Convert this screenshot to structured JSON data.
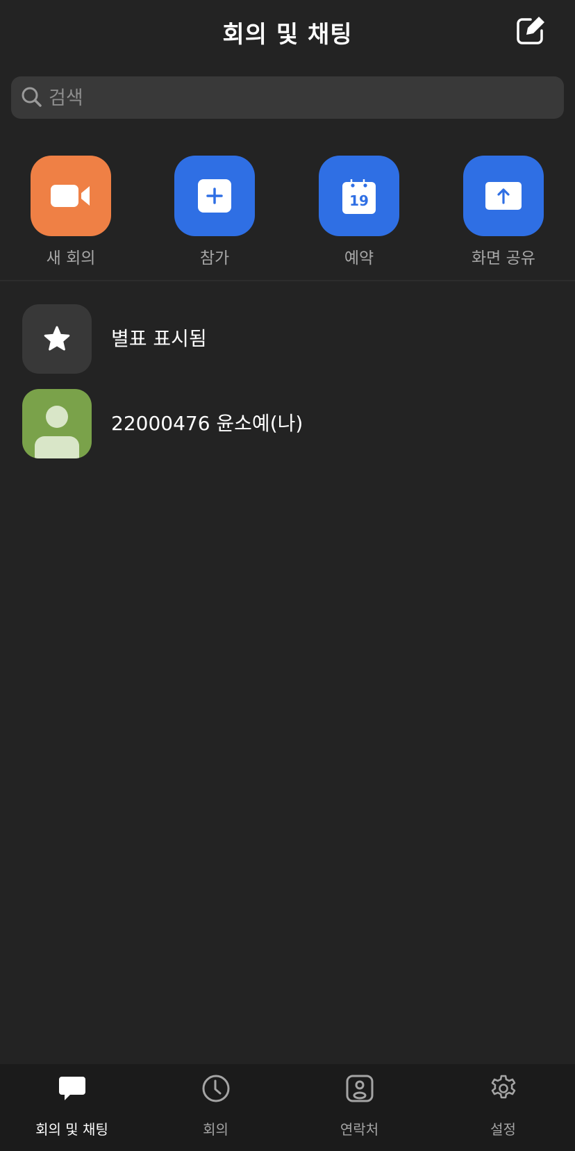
{
  "header": {
    "title": "회의 및 채팅",
    "compose_icon": "compose-icon"
  },
  "search": {
    "placeholder": "검색",
    "icon": "search-icon"
  },
  "quick_actions": [
    {
      "label": "새 회의",
      "icon": "video-camera-icon",
      "color": "#ef8045"
    },
    {
      "label": "참가",
      "icon": "plus-icon",
      "color": "#2f6fe4"
    },
    {
      "label": "예약",
      "icon": "calendar-icon",
      "calendar_day": "19",
      "color": "#2f6fe4"
    },
    {
      "label": "화면 공유",
      "icon": "upload-screen-icon",
      "color": "#2f6fe4"
    }
  ],
  "list": [
    {
      "label": "별표 표시됨",
      "icon": "star-icon",
      "bg": "#383838"
    },
    {
      "label": "22000476 윤소예(나)",
      "icon": "avatar-icon",
      "bg": "#7aa24a"
    }
  ],
  "tabs": [
    {
      "label": "회의 및 채팅",
      "icon": "chat-bubble-icon",
      "active": true
    },
    {
      "label": "회의",
      "icon": "clock-icon",
      "active": false
    },
    {
      "label": "연락처",
      "icon": "contact-card-icon",
      "active": false
    },
    {
      "label": "설정",
      "icon": "gear-icon",
      "active": false
    }
  ]
}
